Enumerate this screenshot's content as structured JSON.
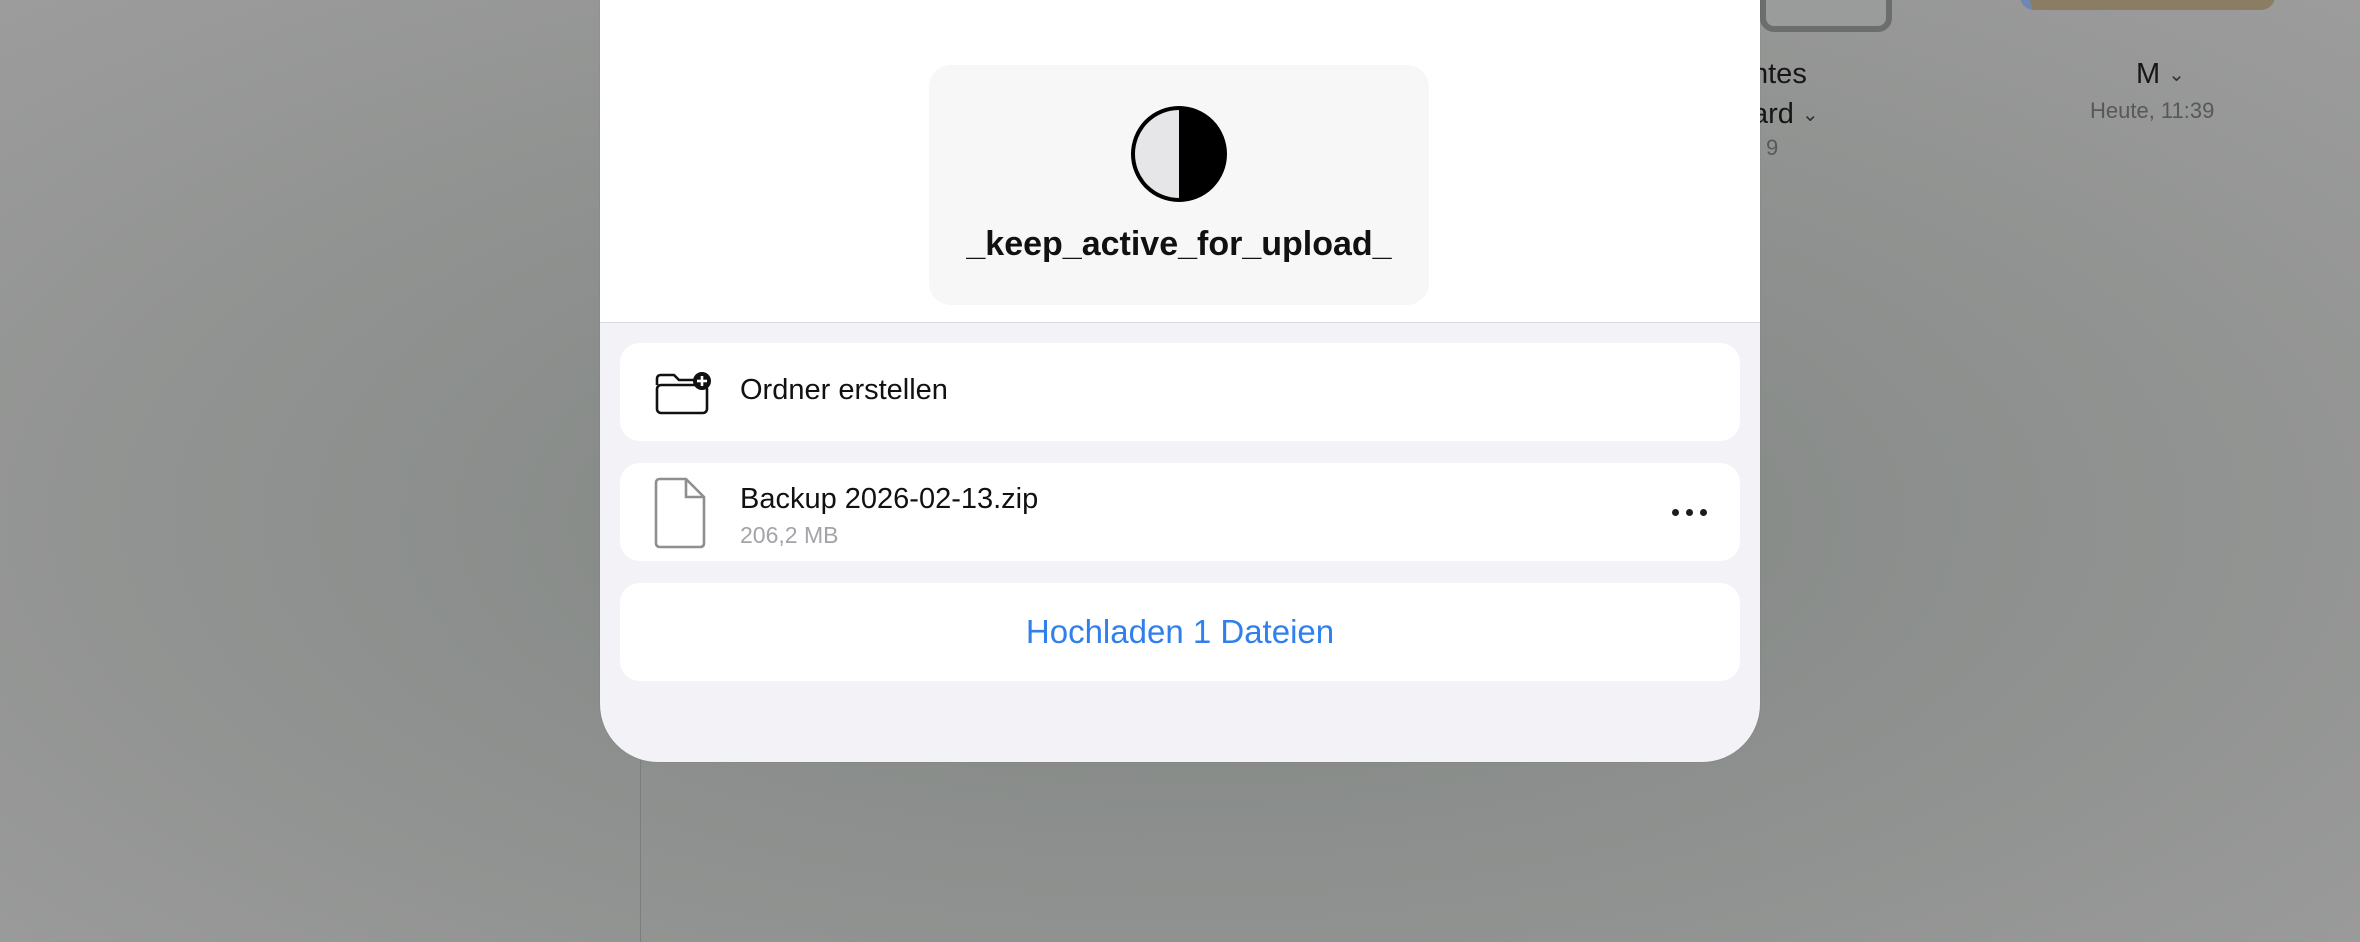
{
  "background": {
    "item_partial_name_line1": "ntes",
    "item_partial_name_line2": "ard",
    "item_partial_sub": "9",
    "item_m_name": "M",
    "item_m_sub": "Heute, 11:39"
  },
  "sheet": {
    "preview": {
      "icon": "circle-half-icon",
      "title": "_keep_active_for_upload_"
    },
    "create_folder": {
      "icon": "folder-plus-icon",
      "label": "Ordner erstellen"
    },
    "file": {
      "icon": "document-icon",
      "name": "Backup 2026-02-13.zip",
      "size": "206,2 MB",
      "more_icon": "ellipsis-icon"
    },
    "upload_button": {
      "label": "Hochladen 1 Dateien",
      "color": "#2f80ed"
    }
  }
}
